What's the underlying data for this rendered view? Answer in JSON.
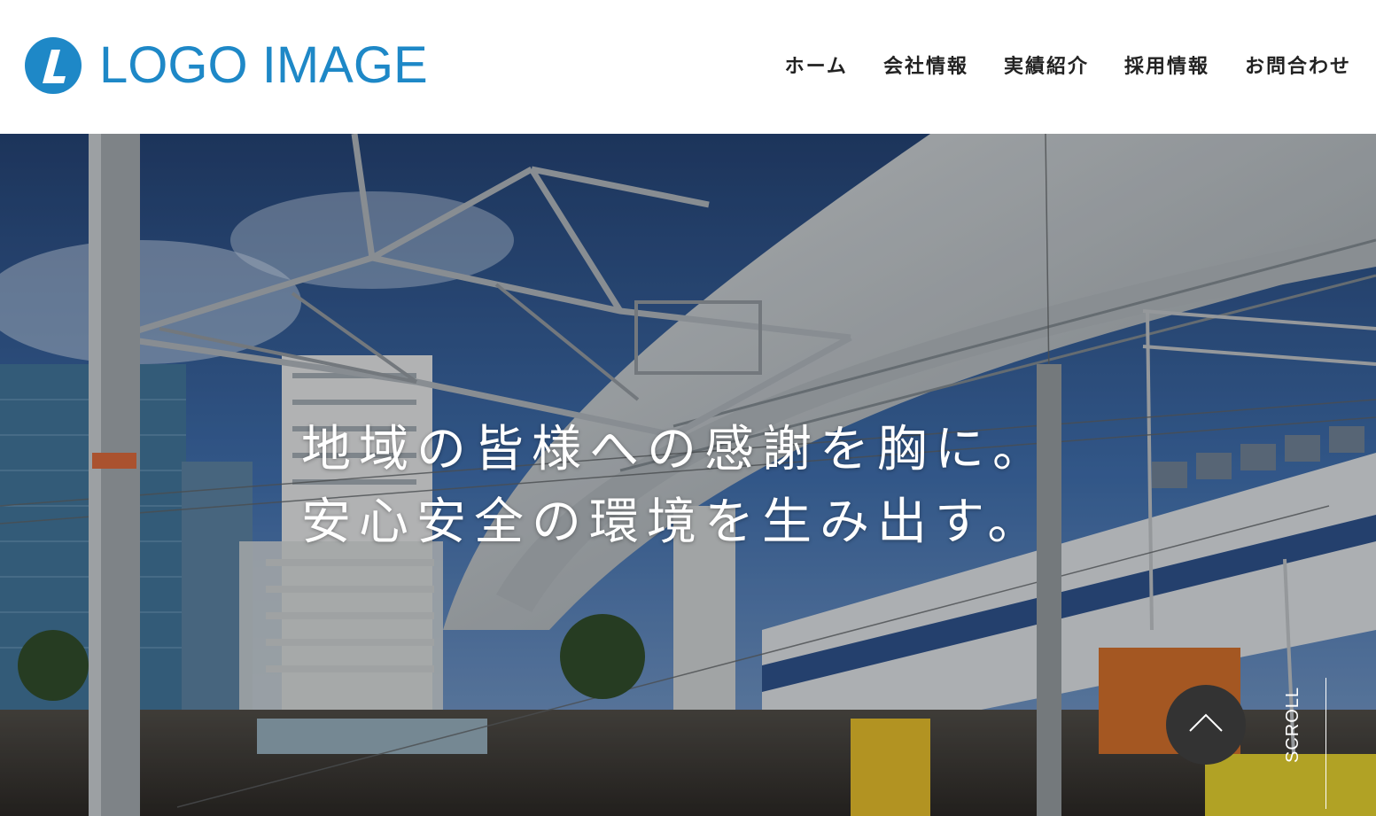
{
  "header": {
    "logo_text": "LOGO IMAGE",
    "logo_mark_letter": "L",
    "brand_color": "#1e88c7"
  },
  "nav": {
    "items": [
      {
        "label": "ホーム"
      },
      {
        "label": "会社情報"
      },
      {
        "label": "実績紹介"
      },
      {
        "label": "採用情報"
      },
      {
        "label": "お問合わせ"
      }
    ]
  },
  "hero": {
    "catch_line1": "地域の皆様への感謝を胸に。",
    "catch_line2": "安心安全の環境を生み出す。",
    "scroll_label": "SCROLL",
    "to_top_icon": "chevron-up-icon"
  }
}
